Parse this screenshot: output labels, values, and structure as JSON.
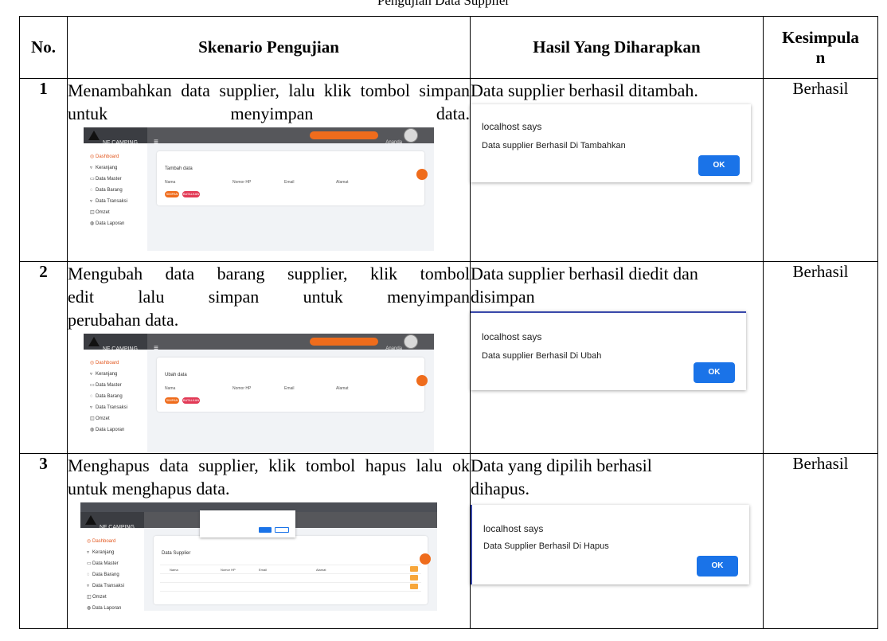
{
  "caption": "Pengujian Data Supplier",
  "headers": {
    "no": "No.",
    "skenario": "Skenario Pengujian",
    "hasil": "Hasil Yang Diharapkan",
    "kesimpulan_line1": "Kesimpula",
    "kesimpulan_line2": "n"
  },
  "rows": [
    {
      "no": "1",
      "skenario": "Menambahkan data supplier, lalu klik tombol simpan untuk menyimpan data.",
      "hasil": "Data supplier berhasil ditambah.",
      "kesimpulan": "Berhasil",
      "dialog": {
        "title": "localhost says",
        "message": "Data supplier Berhasil Di Tambahkan",
        "ok": "OK"
      },
      "app": {
        "card_title": "Tambah data",
        "save": "SIMPAN",
        "cancel": "BATALKAN"
      }
    },
    {
      "no": "2",
      "skenario_line1": "Mengubah data barang supplier, klik tombol",
      "skenario_line2": "edit lalu simpan untuk menyimpan",
      "skenario_line3": "perubahan data.",
      "hasil_line1": "Data supplier berhasil diedit dan",
      "hasil_line2": "disimpan",
      "kesimpulan": "Berhasil",
      "dialog": {
        "title": "localhost says",
        "message": "Data supplier Berhasil Di Ubah",
        "ok": "OK"
      },
      "app": {
        "card_title": "Ubah data",
        "save": "SIMPAN",
        "cancel": "BATALKAN"
      }
    },
    {
      "no": "3",
      "skenario": "Menghapus data supplier, klik tombol hapus lalu ok untuk menghapus data.",
      "hasil_line1": "Data yang dipilih berhasil",
      "hasil_line2": "dihapus.",
      "kesimpulan": "Berhasil",
      "dialog": {
        "title": "localhost says",
        "message": "Data Supplier Berhasil Di Hapus",
        "ok": "OK"
      },
      "app": {
        "card_title": "Data Supplier"
      }
    }
  ],
  "app_common": {
    "brand": "NF CAMPING",
    "user": "Ananda",
    "sidebar": [
      "Dashboard",
      "Keranjang",
      "Data Master",
      "Data Barang",
      "Data Transaksi",
      "Omzet",
      "Data Laporan"
    ],
    "columns": [
      "Nama",
      "Nomor HP",
      "Email",
      "Alamat"
    ]
  }
}
